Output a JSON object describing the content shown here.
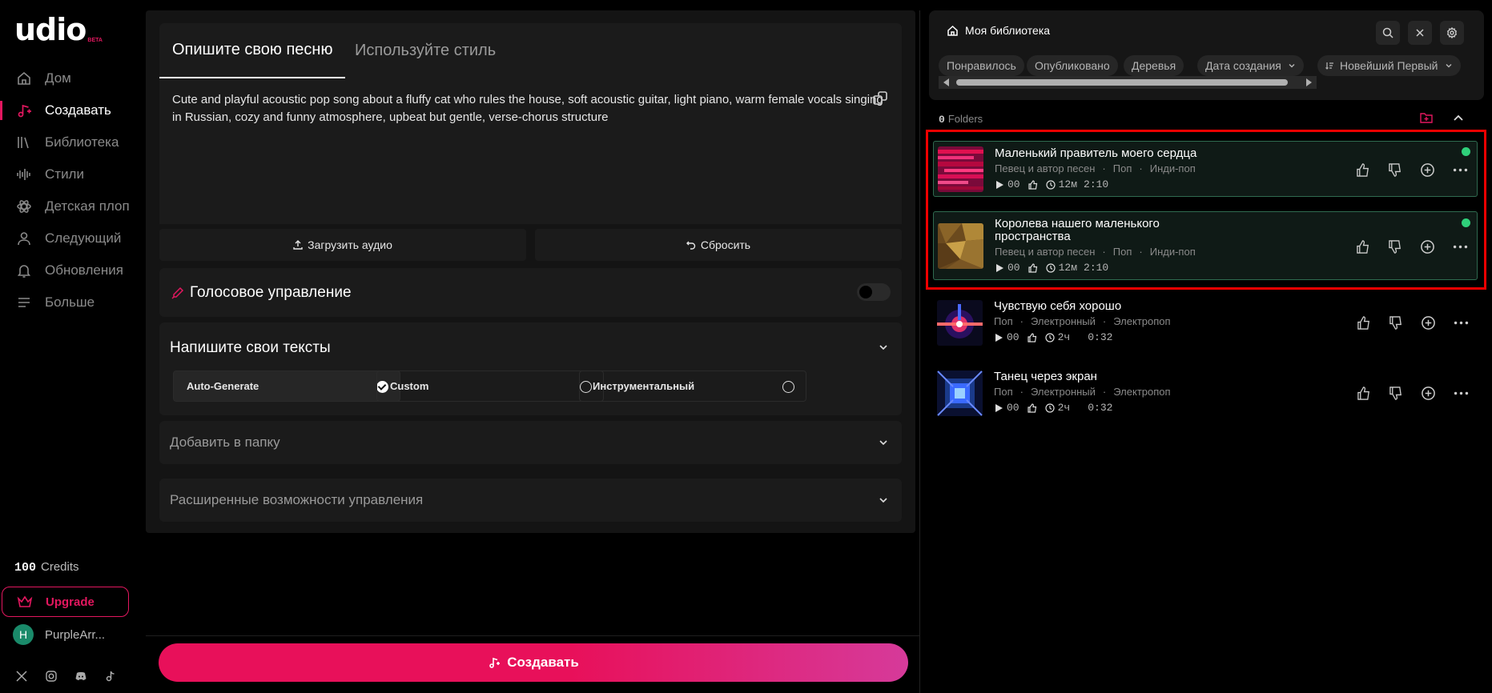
{
  "app": {
    "logo": "udio",
    "beta": "BETA"
  },
  "sidebar": {
    "items": [
      {
        "label": "Дом",
        "icon": "home-icon"
      },
      {
        "label": "Создавать",
        "icon": "music-note-icon",
        "active": true
      },
      {
        "label": "Библиотека",
        "icon": "library-icon"
      },
      {
        "label": "Стили",
        "icon": "waveform-icon"
      },
      {
        "label": "Детская плоп",
        "icon": "atom-icon"
      },
      {
        "label": "Следующий",
        "icon": "user-icon"
      },
      {
        "label": "Обновления",
        "icon": "bell-icon"
      },
      {
        "label": "Больше",
        "icon": "menu-icon"
      }
    ],
    "credits_count": "100",
    "credits_label": "Credits",
    "upgrade": "Upgrade",
    "user": {
      "initial": "H",
      "name": "PurpleArr..."
    },
    "socials": [
      "x-icon",
      "instagram-icon",
      "discord-icon",
      "tiktok-icon"
    ]
  },
  "create": {
    "tabs": [
      "Опишите свою песню",
      "Используйте стиль"
    ],
    "prompt": "Cute and playful acoustic pop song about a fluffy cat who rules the house, soft acoustic guitar, light piano, warm female vocals singing in Russian, cozy and funny atmosphere, upbeat but gentle, verse-chorus structure",
    "upload_audio": "Загрузить аудио",
    "reset": "Сбросить",
    "voice_control": "Голосовое управление",
    "lyrics_title": "Напишите свои тексты",
    "lyrics_options": [
      "Auto-Generate",
      "Custom",
      "Инструментальный"
    ],
    "add_to_folder": "Добавить в папку",
    "advanced": "Расширенные возможности управления",
    "create_button": "Создавать"
  },
  "library": {
    "title": "Моя библиотека",
    "filters": [
      "Понравилось",
      "Опубликовано",
      "Деревья",
      "Дата создания",
      "Новейший Первый"
    ],
    "folders_count": "0",
    "folders_label": "Folders",
    "songs": [
      {
        "title": "Маленький правитель моего сердца",
        "tags": [
          "Певец и автор песен",
          "Поп",
          "Инди-поп"
        ],
        "plays": "00",
        "age": "12м",
        "duration": "2:10",
        "selected": true
      },
      {
        "title": "Королева нашего маленького пространства",
        "tags": [
          "Певец и автор песен",
          "Поп",
          "Инди-поп"
        ],
        "plays": "00",
        "age": "12м",
        "duration": "2:10",
        "selected": true
      },
      {
        "title": "Чувствую себя хорошо",
        "tags": [
          "Поп",
          "Электронный",
          "Электропоп"
        ],
        "plays": "00",
        "age": "2ч",
        "duration": "0:32",
        "selected": false
      },
      {
        "title": "Танец через экран",
        "tags": [
          "Поп",
          "Электронный",
          "Электропоп"
        ],
        "plays": "00",
        "age": "2ч",
        "duration": "0:32",
        "selected": false
      }
    ]
  },
  "colors": {
    "accent": "#e3175f",
    "live": "#2fd07a",
    "highlight": "#ee0000"
  }
}
